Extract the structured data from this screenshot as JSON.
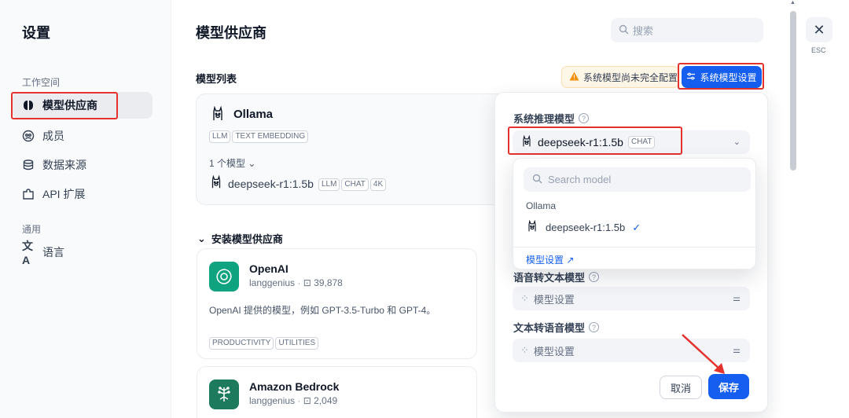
{
  "sidebar": {
    "title": "设置",
    "workspace_label": "工作空间",
    "items": [
      {
        "label": "模型供应商",
        "icon": "brain-icon"
      },
      {
        "label": "成员",
        "icon": "members-icon"
      },
      {
        "label": "数据来源",
        "icon": "database-icon"
      },
      {
        "label": "API 扩展",
        "icon": "api-extension-icon"
      }
    ],
    "general_label": "通用",
    "language": {
      "label": "语言",
      "icon": "translate-icon"
    }
  },
  "header": {
    "title": "模型供应商",
    "search_placeholder": "搜索"
  },
  "model_list": {
    "title": "模型列表",
    "warning": "系统模型尚未完全配置",
    "system_button": "系统模型设置"
  },
  "ollama": {
    "name": "Ollama",
    "tags": [
      "LLM",
      "TEXT EMBEDDING"
    ],
    "model_count": "1 个模型",
    "model": {
      "name": "deepseek-r1:1.5b",
      "tags": [
        "LLM",
        "CHAT",
        "4K"
      ]
    }
  },
  "install": {
    "title": "安装模型供应商",
    "providers": [
      {
        "name": "OpenAI",
        "author": "langgenius",
        "downloads": "39,878",
        "description": "OpenAI 提供的模型，例如 GPT-3.5-Turbo 和 GPT-4。",
        "tags": [
          "PRODUCTIVITY",
          "UTILITIES"
        ],
        "color": "#10a37f"
      },
      {
        "name": "Amazon Bedrock",
        "author": "langgenius",
        "downloads": "2,049",
        "color": "#1e7a5c"
      }
    ]
  },
  "system_panel": {
    "reasoning_label": "系统推理模型",
    "selected_model": "deepseek-r1:1.5b",
    "selected_tag": "CHAT",
    "dropdown": {
      "search_placeholder": "Search model",
      "group": "Ollama",
      "item": "deepseek-r1:1.5b",
      "footer_link": "模型设置"
    },
    "stt_label": "语音转文本模型",
    "stt_placeholder": "模型设置",
    "tts_label": "文本转语音模型",
    "tts_placeholder": "模型设置",
    "cancel": "取消",
    "save": "保存"
  },
  "close": {
    "esc_label": "ESC"
  },
  "colors": {
    "accent": "#155eef",
    "annotation_red": "#e5322d",
    "warning": "#f79009"
  }
}
